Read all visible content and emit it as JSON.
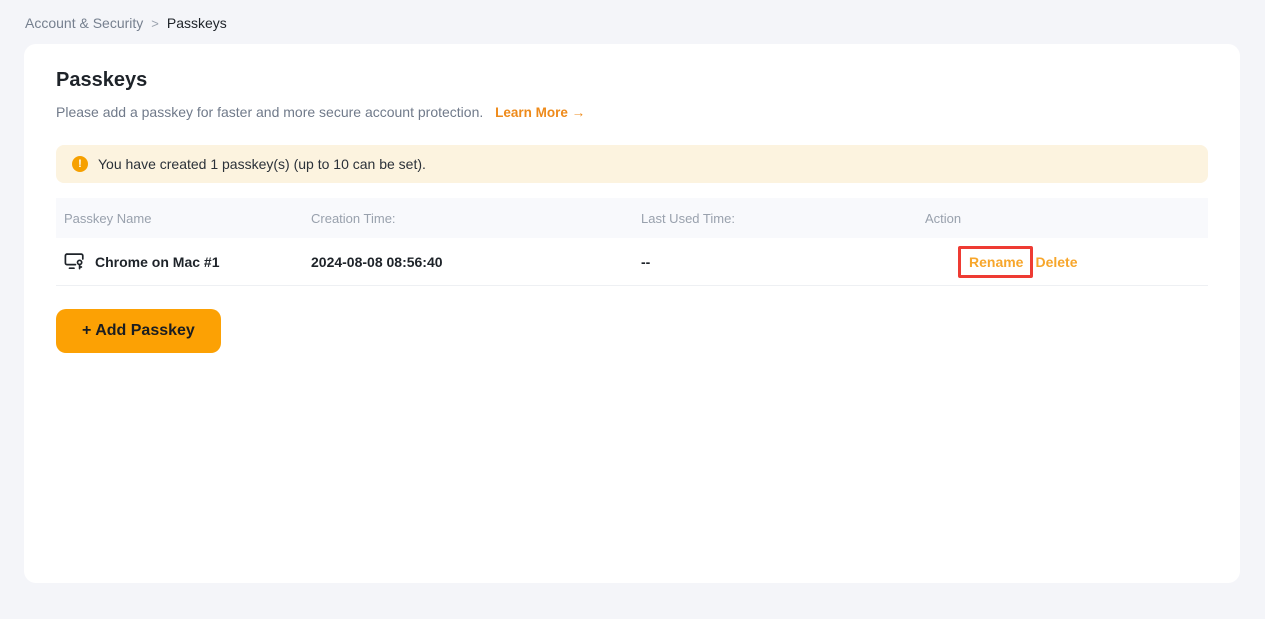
{
  "breadcrumb": {
    "items": [
      {
        "label": "Account & Security"
      },
      {
        "label": "Passkeys"
      }
    ],
    "separator": ">"
  },
  "header": {
    "title": "Passkeys",
    "description": "Please add a passkey for faster and more secure account protection.",
    "learn_more_label": "Learn More →"
  },
  "banner": {
    "icon": "exclamation-circle-icon",
    "text": "You have created 1 passkey(s) (up to 10 can be set)."
  },
  "table": {
    "columns": {
      "name": "Passkey Name",
      "creation": "Creation Time:",
      "last_used": "Last Used Time:",
      "action": "Action"
    },
    "rows": [
      {
        "icon": "passkey-device-icon",
        "name": "Chrome on Mac #1",
        "creation_time": "2024-08-08 08:56:40",
        "last_used_time": "--",
        "actions": {
          "rename": "Rename",
          "delete": "Delete"
        },
        "annotation": "red-highlight-box-on-rename"
      }
    ]
  },
  "buttons": {
    "add_passkey": "+ Add Passkey"
  },
  "colors": {
    "page_background": "#F4F5F9",
    "card_background": "#FFFFFF",
    "accent_button": "#FCA104",
    "action_link": "#F7A62B",
    "learn_more_link": "#EE8A1A",
    "banner_background": "#FCF3DF",
    "banner_icon": "#F6A000",
    "annotation_red": "#EE3B33",
    "text_primary": "#1E2329",
    "text_secondary": "#707A8A",
    "table_header_bg": "#F8F9FC"
  }
}
